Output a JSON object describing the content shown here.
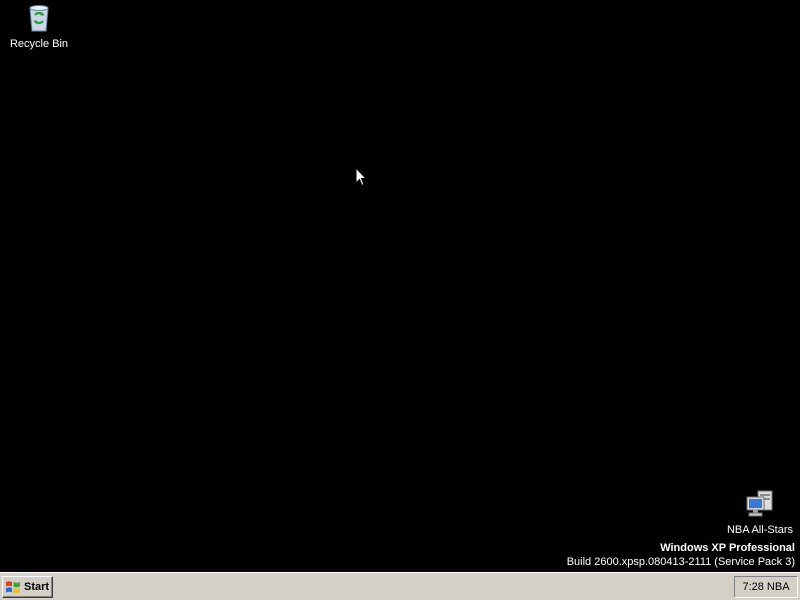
{
  "desktop": {
    "background_color": "#000000",
    "icons": [
      {
        "label": "Recycle Bin",
        "icon": "recycle-bin-icon"
      },
      {
        "label": "NBA All-Stars",
        "icon": "network-computer-icon"
      }
    ]
  },
  "watermark": {
    "product": "Windows XP Professional",
    "build": "Build 2600.xpsp.080413-2111 (Service Pack 3)"
  },
  "taskbar": {
    "background_color": "#d4d0c8",
    "start_label": "Start",
    "start_icon": "windows-logo-icon",
    "clock": "7:28 NBA"
  },
  "cursor": {
    "icon": "arrow-pointer-icon"
  }
}
